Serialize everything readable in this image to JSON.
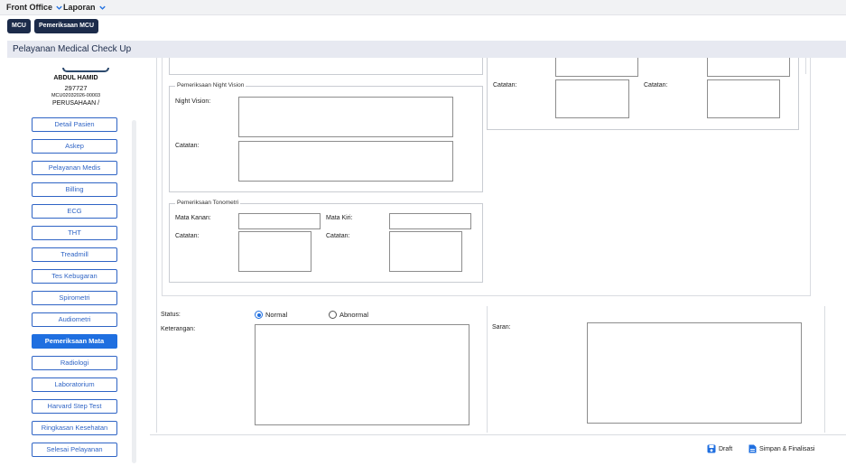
{
  "topnav": {
    "front_office": "Front Office",
    "laporan": "Laporan"
  },
  "breadcrumbs": [
    "MCU",
    "Pemeriksaan MCU"
  ],
  "section_title": "Pelayanan Medical Check Up",
  "patient": {
    "name": "ABDUL HAMID",
    "id": "297727",
    "mcu_no": "MCU02032026-00003",
    "company": "PERUSAHAAN /"
  },
  "menu": [
    {
      "label": "Detail Pasien",
      "active": false
    },
    {
      "label": "Askep",
      "active": false
    },
    {
      "label": "Pelayanan Medis",
      "active": false
    },
    {
      "label": "Billing",
      "active": false
    },
    {
      "label": "ECG",
      "active": false
    },
    {
      "label": "THT",
      "active": false
    },
    {
      "label": "Treadmill",
      "active": false
    },
    {
      "label": "Tes Kebugaran",
      "active": false
    },
    {
      "label": "Spirometri",
      "active": false
    },
    {
      "label": "Audiometri",
      "active": false
    },
    {
      "label": "Pemeriksaan Mata",
      "active": true
    },
    {
      "label": "Radiologi",
      "active": false
    },
    {
      "label": "Laboratorium",
      "active": false
    },
    {
      "label": "Harvard Step Test",
      "active": false
    },
    {
      "label": "Ringkasan Kesehatan",
      "active": false
    },
    {
      "label": "Selesai Pelayanan",
      "active": false
    }
  ],
  "night_vision": {
    "legend": "Pemeriksaan Night Vision",
    "night_vision_label": "Night Vision:",
    "night_vision_value": "",
    "catatan_label": "Catatan:",
    "catatan_value": ""
  },
  "tonometri": {
    "legend": "Pemeriksaan Tonometri",
    "mata_kanan_label": "Mata Kanan:",
    "mata_kanan_value": "",
    "mata_kiri_label": "Mata Kiri:",
    "mata_kiri_value": "",
    "catatan_kanan_label": "Catatan:",
    "catatan_kanan_value": "",
    "catatan_kiri_label": "Catatan:",
    "catatan_kiri_value": ""
  },
  "right_top": {
    "catatan_left_label": "Catatan:",
    "catatan_left_value": "",
    "catatan_right_label": "Catatan:",
    "catatan_right_value": ""
  },
  "status": {
    "label": "Status:",
    "options": [
      "Normal",
      "Abnormal"
    ],
    "selected": "Normal"
  },
  "keterangan": {
    "label": "Keterangan:",
    "value": ""
  },
  "saran": {
    "label": "Saran:",
    "value": ""
  },
  "actions": {
    "draft": "Draft",
    "finalize": "Simpan & Finalisasi"
  },
  "colors": {
    "navy": "#1c2b4a",
    "accent": "#1f6fe0",
    "menu_border": "#2f64c5"
  }
}
